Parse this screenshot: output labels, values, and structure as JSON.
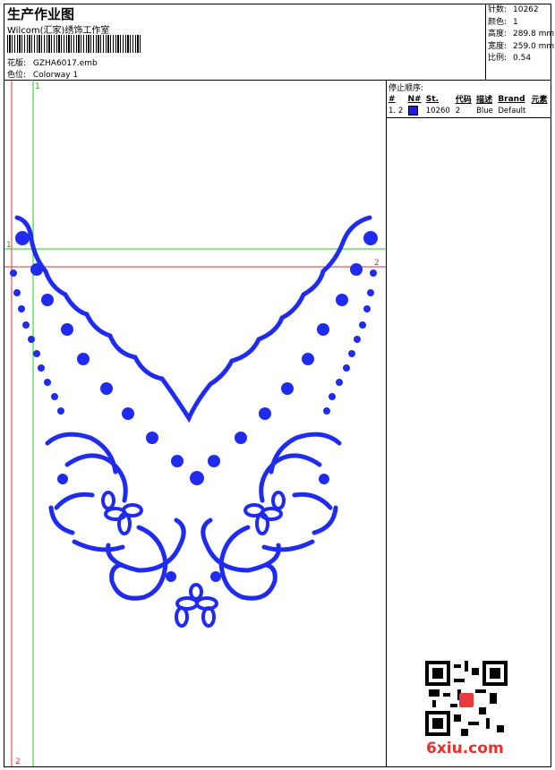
{
  "header": {
    "title": "生产作业图",
    "studio": "Wilcom(汇家)绣饰工作室",
    "design_label": "花版:",
    "design_value": "GZHA6017.emb",
    "color_label": "色位:",
    "color_value": "Colorway 1"
  },
  "stats": [
    {
      "label": "针数:",
      "value": "10262"
    },
    {
      "label": "颜色:",
      "value": "1"
    },
    {
      "label": "高度:",
      "value": "289.8 mm"
    },
    {
      "label": "宽度:",
      "value": "259.0 mm"
    },
    {
      "label": "比例:",
      "value": "0.54"
    }
  ],
  "stop_sequence": {
    "caption": "停止顺序:",
    "columns": [
      "#",
      "N#",
      "St.",
      "代码",
      "描述",
      "Brand",
      "元素"
    ],
    "rows": [
      {
        "num": "1.",
        "n": "2",
        "stitches": "10260",
        "code": "2",
        "desc": "Blue",
        "brand": "Default",
        "swatch": "#1a1aff"
      }
    ]
  },
  "guides": {
    "v1": "1",
    "h1": "1",
    "h2": "2",
    "v2": "2"
  },
  "design": {
    "thread_color": "#1f2cf0"
  },
  "watermark": "6xiu.com"
}
